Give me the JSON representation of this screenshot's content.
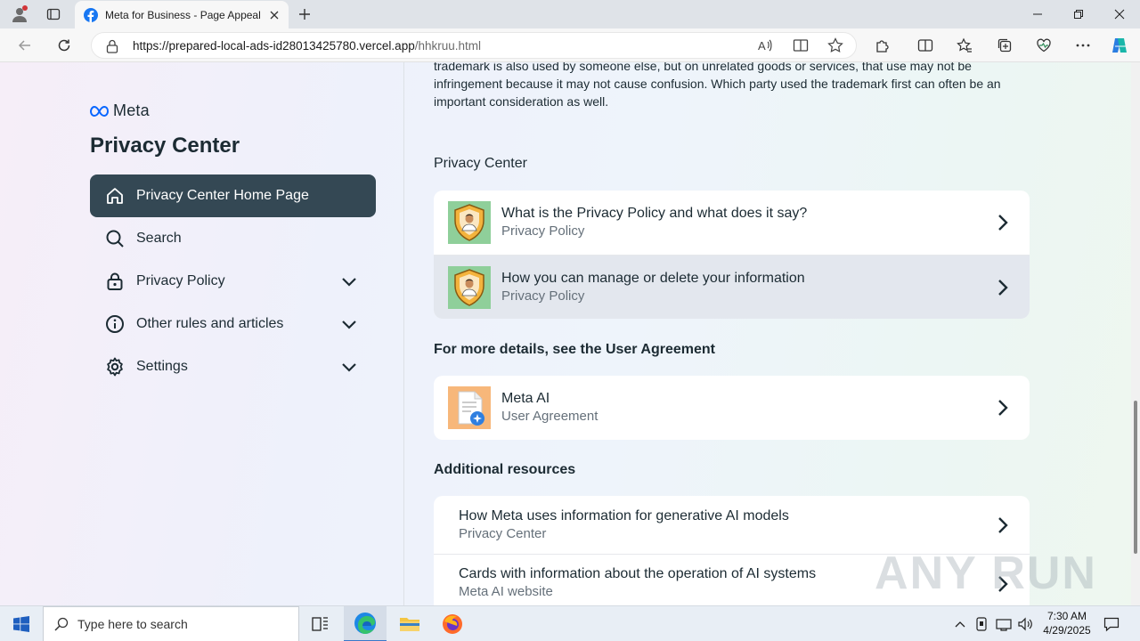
{
  "browser": {
    "tab_title": "Meta for Business - Page Appeal",
    "url_host": "https://prepared-local-ads-id28013425780.vercel.app",
    "url_path": "/hhkruu.html"
  },
  "sidebar": {
    "brand": "Meta",
    "title": "Privacy Center",
    "items": [
      {
        "label": "Privacy Center Home Page",
        "icon": "home-icon",
        "active": true
      },
      {
        "label": "Search",
        "icon": "search-icon"
      },
      {
        "label": "Privacy Policy",
        "icon": "lock-icon",
        "expandable": true
      },
      {
        "label": "Other rules and articles",
        "icon": "info-icon",
        "expandable": true
      },
      {
        "label": "Settings",
        "icon": "gear-icon",
        "expandable": true
      }
    ]
  },
  "main": {
    "intro": "trademark is also used by someone else, but on unrelated goods or services, that use may not be infringement because it may not cause confusion. Which party used the trademark first can often be an important consideration as well.",
    "sections": [
      {
        "heading": "Privacy Center",
        "items": [
          {
            "title": "What is the Privacy Policy and what does it say?",
            "subtitle": "Privacy Policy"
          },
          {
            "title": "How you can manage or delete your information",
            "subtitle": "Privacy Policy"
          }
        ]
      },
      {
        "heading": "For more details, see the User Agreement",
        "items": [
          {
            "title": "Meta AI",
            "subtitle": "User Agreement"
          }
        ]
      },
      {
        "heading": "Additional resources",
        "items": [
          {
            "title": "How Meta uses information for generative AI models",
            "subtitle": "Privacy Center"
          },
          {
            "title": "Cards with information about the operation of AI systems",
            "subtitle": "Meta AI website"
          }
        ]
      }
    ]
  },
  "watermark": "ANY RUN",
  "taskbar": {
    "search_placeholder": "Type here to search",
    "time": "7:30 AM",
    "date": "4/29/2025"
  },
  "colors": {
    "active_nav": "#344854",
    "meta_blue": "#0866ff",
    "text_primary": "#1c2b33",
    "text_secondary": "#65707a"
  }
}
